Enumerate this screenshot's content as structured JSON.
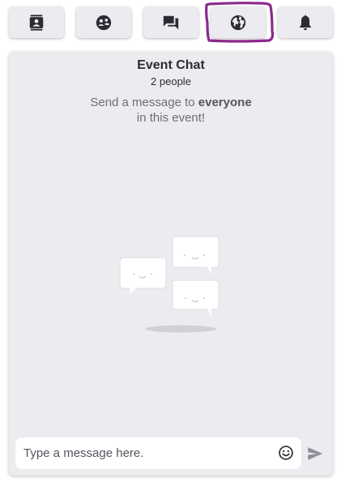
{
  "toolbar": {
    "tabs": [
      {
        "icon": "contacts-icon"
      },
      {
        "icon": "emoji-people-icon"
      },
      {
        "icon": "chat-bubbles-icon"
      },
      {
        "icon": "globe-icon",
        "highlighted": true
      },
      {
        "icon": "bell-icon"
      }
    ],
    "highlight_color": "#8a2a8c"
  },
  "chat": {
    "title": "Event Chat",
    "subtitle": "2 people",
    "empty_prefix": "Send a message to",
    "empty_bold": "everyone",
    "empty_suffix": "in this event!"
  },
  "composer": {
    "placeholder": "Type a message here.",
    "emoji_icon": "smiley-icon",
    "send_icon": "send-icon"
  },
  "colors": {
    "panel_bg": "#ebebf0",
    "icon": "#2b2b33",
    "muted_text": "#6e6e7a"
  }
}
